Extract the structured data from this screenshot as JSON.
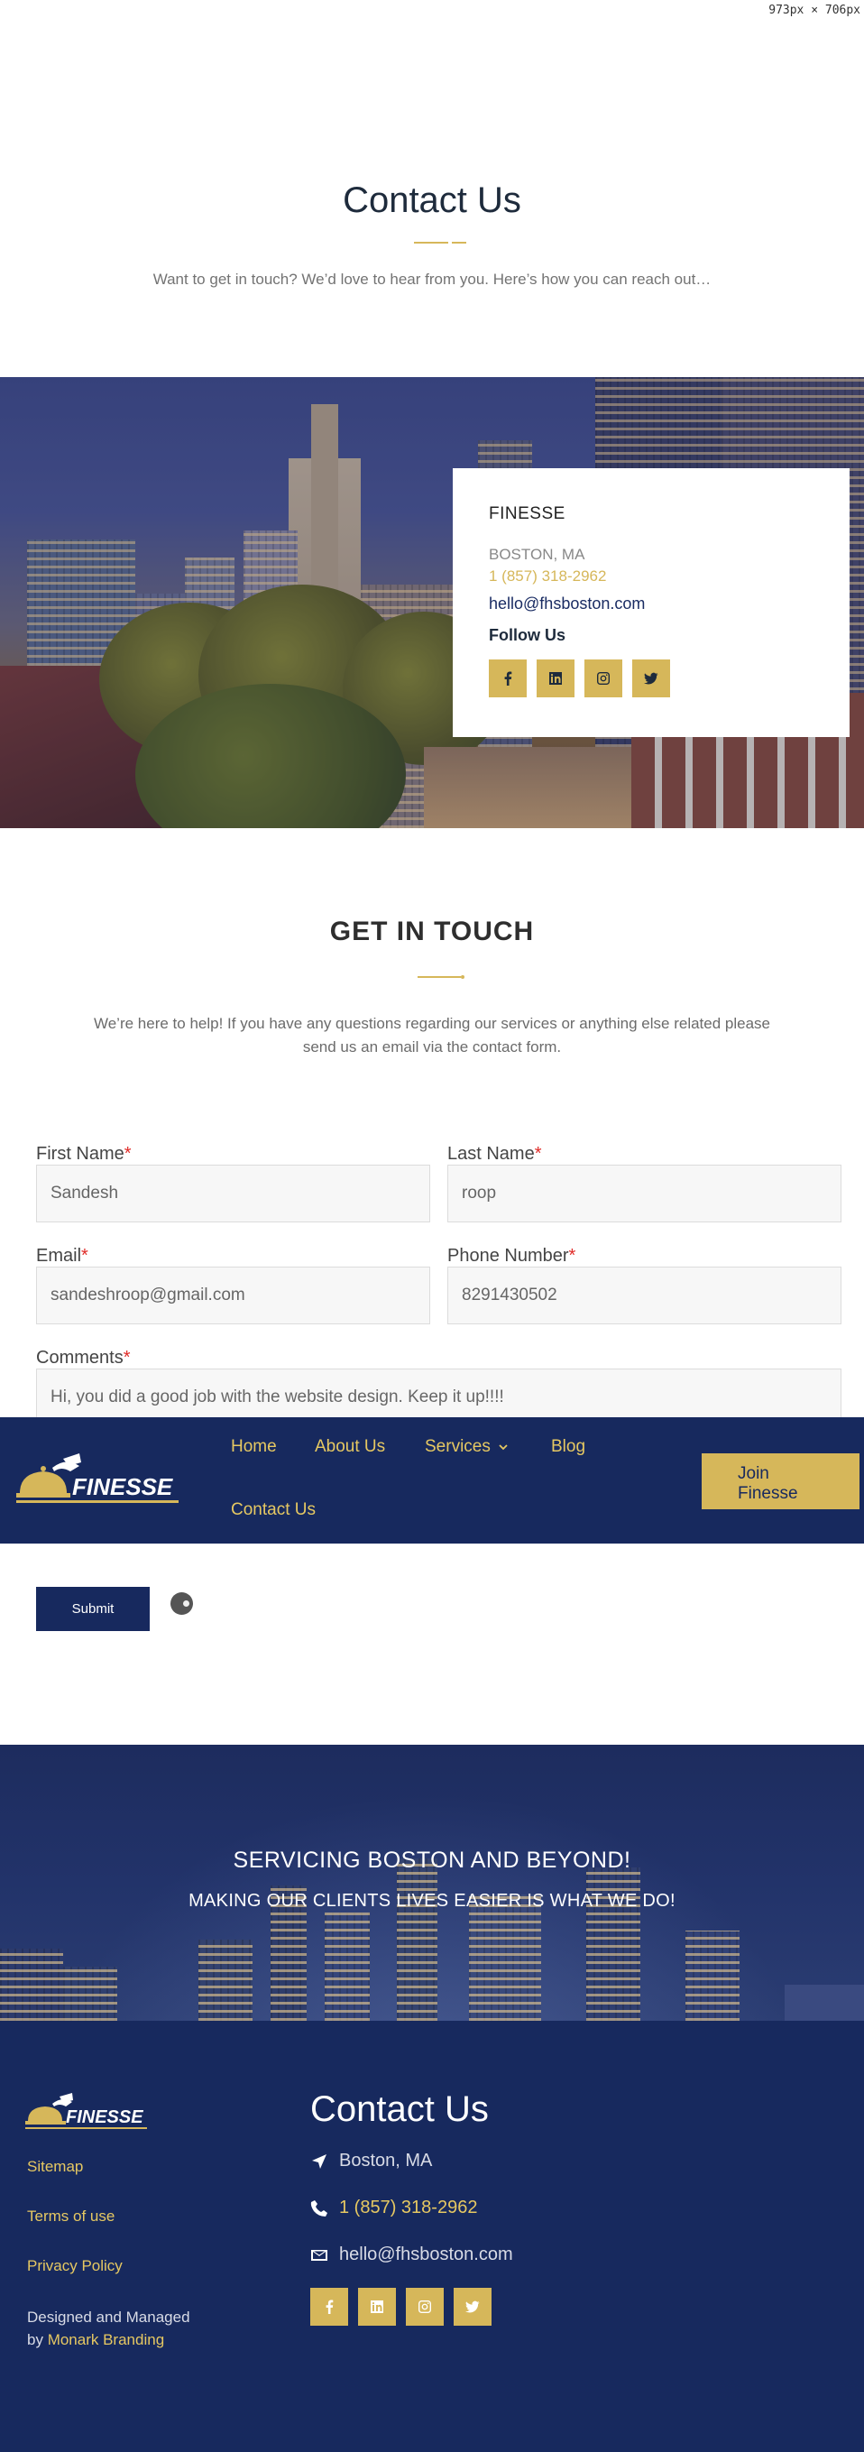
{
  "viewport_label": "973px × 706px",
  "hero": {
    "title": "Contact Us",
    "subtitle": "Want to get in touch? We’d love to hear from you. Here’s how you can reach out…"
  },
  "info_card": {
    "brand": "FINESSE",
    "city": "BOSTON, MA",
    "phone": "1 (857) 318-2962",
    "email": "hello@fhsboston.com",
    "follow_label": "Follow Us",
    "socials": [
      "facebook-icon",
      "linkedin-icon",
      "instagram-icon",
      "twitter-icon"
    ]
  },
  "get_in_touch": {
    "title": "GET IN TOUCH",
    "text": "We’re here to help! If you have any questions regarding our services or anything else related please send us an email via the contact form."
  },
  "form": {
    "first_name": {
      "label": "First Name",
      "required_mark": "*",
      "value": "Sandesh"
    },
    "last_name": {
      "label": "Last Name",
      "required_mark": "*",
      "value": "roop"
    },
    "email": {
      "label": "Email",
      "required_mark": "*",
      "value": "sandeshroop@gmail.com"
    },
    "phone": {
      "label": "Phone Number",
      "required_mark": "*",
      "value": "8291430502"
    },
    "comments": {
      "label": "Comments",
      "required_mark": "*",
      "value": "Hi, you did a good job with the website design. Keep it up!!!!"
    },
    "submit_label": "Submit"
  },
  "nav": {
    "logo_text": "FINESSE",
    "items": {
      "home": "Home",
      "about": "About Us",
      "services": "Services",
      "blog": "Blog",
      "contact": "Contact Us"
    },
    "join_label_line1": "Join",
    "join_label_line2": "Finesse"
  },
  "boston": {
    "heading": "SERVICING BOSTON AND BEYOND!",
    "subheading": "MAKING OUR CLIENTS LIVES EASIER IS WHAT WE DO!"
  },
  "footer": {
    "logo_text": "FINESSE",
    "links": {
      "sitemap": "Sitemap",
      "terms": "Terms of use",
      "privacy": "Privacy Policy"
    },
    "credit_line1": "Designed and Managed",
    "credit_by": "by ",
    "credit_brand": "Monark Branding",
    "contact_title": "Contact Us",
    "city": "Boston, MA",
    "phone": "1 (857) 318-2962",
    "email": "hello@fhsboston.com"
  },
  "colors": {
    "gold": "#d6b75a",
    "navy": "#17295e",
    "heading": "#1e2b3c",
    "required": "#e02b27"
  }
}
